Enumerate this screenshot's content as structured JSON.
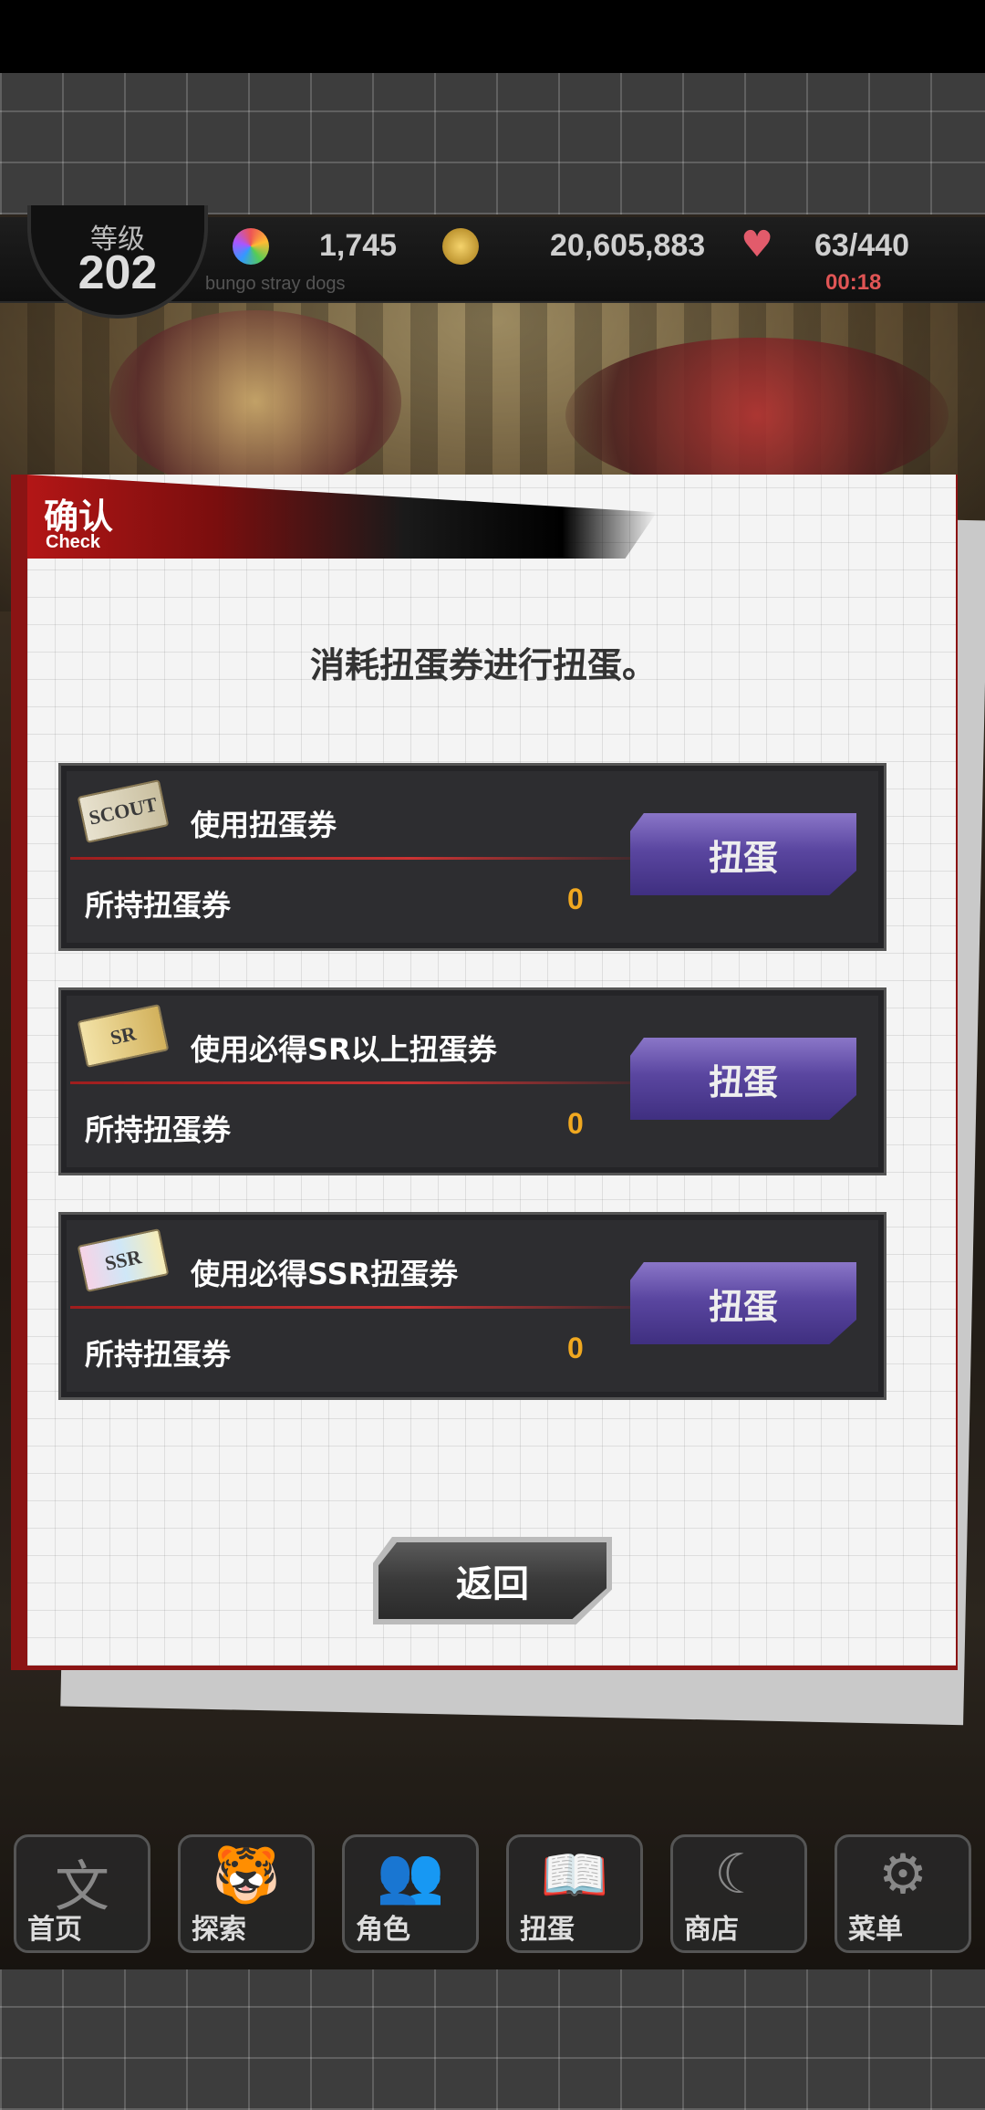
{
  "header": {
    "level_label": "等级",
    "level_value": "202",
    "subtitle": "bungo stray dogs",
    "gems": "1,745",
    "coins": "20,605,883",
    "stamina": "63/440",
    "stamina_timer": "00:18"
  },
  "dialog": {
    "title": "确认",
    "title_en": "Check",
    "message": "消耗扭蛋券进行扭蛋。",
    "rows": [
      {
        "ticket_text": "SCOUT",
        "title": "使用扭蛋券",
        "label": "所持扭蛋券",
        "count": "0",
        "button": "扭蛋"
      },
      {
        "ticket_text": "SR",
        "title": "使用必得SR以上扭蛋券",
        "label": "所持扭蛋券",
        "count": "0",
        "button": "扭蛋"
      },
      {
        "ticket_text": "SSR",
        "title": "使用必得SSR扭蛋券",
        "label": "所持扭蛋券",
        "count": "0",
        "button": "扭蛋"
      }
    ],
    "back_label": "返回"
  },
  "nav": [
    {
      "label": "首页",
      "icon": "home-icon"
    },
    {
      "label": "探索",
      "icon": "tiger-icon"
    },
    {
      "label": "角色",
      "icon": "people-icon"
    },
    {
      "label": "扭蛋",
      "icon": "book-icon"
    },
    {
      "label": "商店",
      "icon": "moon-icon"
    },
    {
      "label": "菜单",
      "icon": "gear-icon"
    }
  ]
}
